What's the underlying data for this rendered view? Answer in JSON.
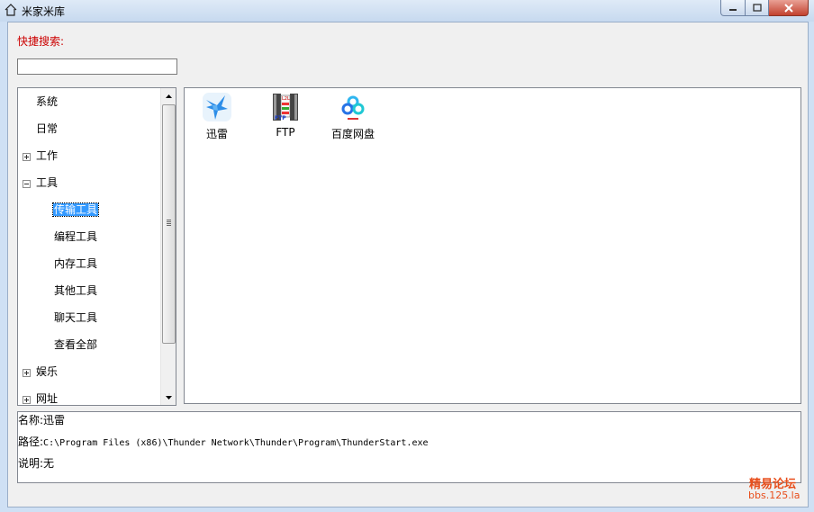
{
  "window": {
    "title": "米家米库"
  },
  "search": {
    "label": "快捷搜索:",
    "value": "",
    "placeholder": ""
  },
  "tree": {
    "items": [
      {
        "label": "系统"
      },
      {
        "label": "日常"
      },
      {
        "label": "工作"
      },
      {
        "label": "工具"
      },
      {
        "label": "传输工具"
      },
      {
        "label": "编程工具"
      },
      {
        "label": "内存工具"
      },
      {
        "label": "其他工具"
      },
      {
        "label": "聊天工具"
      },
      {
        "label": "查看全部"
      },
      {
        "label": "娱乐"
      },
      {
        "label": "网址"
      }
    ]
  },
  "apps": [
    {
      "label": "迅雷",
      "icon": "thunder-icon"
    },
    {
      "label": "FTP",
      "icon": "ftp-icon"
    },
    {
      "label": "百度网盘",
      "icon": "baidu-netdisk-icon"
    }
  ],
  "info": {
    "name_label": "名称:",
    "name_value": "迅雷",
    "path_label": "路径:",
    "path_value": "C:\\Program Files (x86)\\Thunder Network\\Thunder\\Program\\ThunderStart.exe",
    "desc_label": "说明:",
    "desc_value": "无"
  },
  "watermark": {
    "line1": "精易论坛",
    "line2": "bbs.125.la"
  },
  "colors": {
    "search_label": "#cc0000",
    "selection": "#3399ff",
    "watermark": "#e84e1b"
  }
}
